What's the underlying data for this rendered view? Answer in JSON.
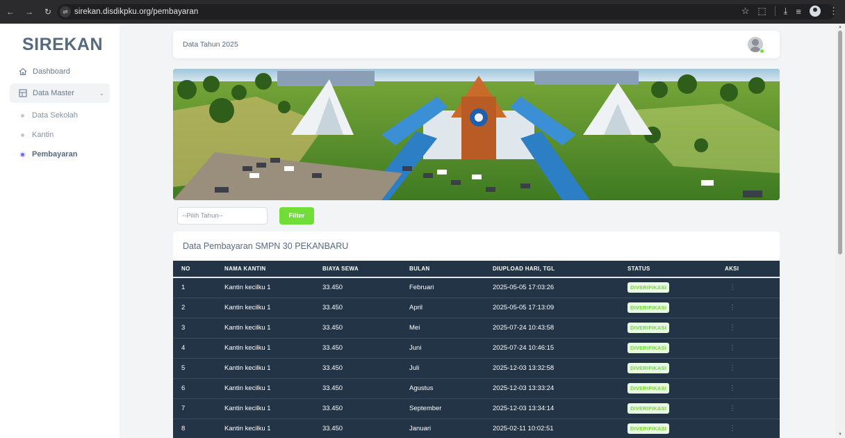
{
  "browser": {
    "url": "sirekan.disdikpku.org/pembayaran",
    "icons": [
      "back-arrow-icon",
      "forward-arrow-icon",
      "reload-icon",
      "site-settings-icon",
      "bookmark-star-icon",
      "extensions-icon",
      "download-icon",
      "reading-list-icon",
      "profile-icon",
      "menu-dots-icon"
    ]
  },
  "sidebar": {
    "brand": "SIREKAN",
    "items": [
      {
        "label": "Dashboard",
        "icon": "home-icon"
      },
      {
        "label": "Data Master",
        "icon": "grid-icon"
      }
    ],
    "subitems": [
      {
        "label": "Data Sekolah"
      },
      {
        "label": "Kantin"
      },
      {
        "label": "Pembayaran",
        "active": true
      }
    ]
  },
  "topbar": {
    "title": "Data Tahun 2025"
  },
  "filter": {
    "select_value": "--Pilih Tahun--",
    "button_label": "Filter"
  },
  "table": {
    "title": "Data Pembayaran SMPN 30 PEKANBARU",
    "columns": [
      "NO",
      "NAMA KANTIN",
      "BIAYA SEWA",
      "BULAN",
      "DIUPLOAD HARI, TGL",
      "STATUS",
      "AKSI"
    ],
    "rows": [
      {
        "no": "1",
        "nama": "Kantin kecilku 1",
        "biaya": "33.450",
        "bulan": "Februari",
        "tgl": "2025-05-05 17:03:26",
        "status": "DIVERIFIKASI",
        "aksi": "⋮"
      },
      {
        "no": "2",
        "nama": "Kantin kecilku 1",
        "biaya": "33.450",
        "bulan": "April",
        "tgl": "2025-05-05 17:13:09",
        "status": "DIVERIFIKASI",
        "aksi": "⋮"
      },
      {
        "no": "3",
        "nama": "Kantin kecilku 1",
        "biaya": "33.450",
        "bulan": "Mei",
        "tgl": "2025-07-24 10:43:58",
        "status": "DIVERIFIKASI",
        "aksi": "⋮"
      },
      {
        "no": "4",
        "nama": "Kantin kecilku 1",
        "biaya": "33.450",
        "bulan": "Juni",
        "tgl": "2025-07-24 10:46:15",
        "status": "DIVERIFIKASI",
        "aksi": "⋮"
      },
      {
        "no": "5",
        "nama": "Kantin kecilku 1",
        "biaya": "33.450",
        "bulan": "Juli",
        "tgl": "2025-12-03 13:32:58",
        "status": "DIVERIFIKASI",
        "aksi": "⋮"
      },
      {
        "no": "6",
        "nama": "Kantin kecilku 1",
        "biaya": "33.450",
        "bulan": "Agustus",
        "tgl": "2025-12-03 13:33:24",
        "status": "DIVERIFIKASI",
        "aksi": "⋮"
      },
      {
        "no": "7",
        "nama": "Kantin kecilku 1",
        "biaya": "33.450",
        "bulan": "September",
        "tgl": "2025-12-03 13:34:14",
        "status": "DIVERIFIKASI",
        "aksi": "⋮"
      },
      {
        "no": "8",
        "nama": "Kantin kecilku 1",
        "biaya": "33.450",
        "bulan": "Januari",
        "tgl": "2025-02-11 10:02:51",
        "status": "DIVERIFIKASI",
        "aksi": "⋮"
      }
    ]
  },
  "colors": {
    "sidebar_active": "#696cff",
    "success": "#71dd37",
    "table_bg": "#233446",
    "brand_text": "#566a7f"
  }
}
